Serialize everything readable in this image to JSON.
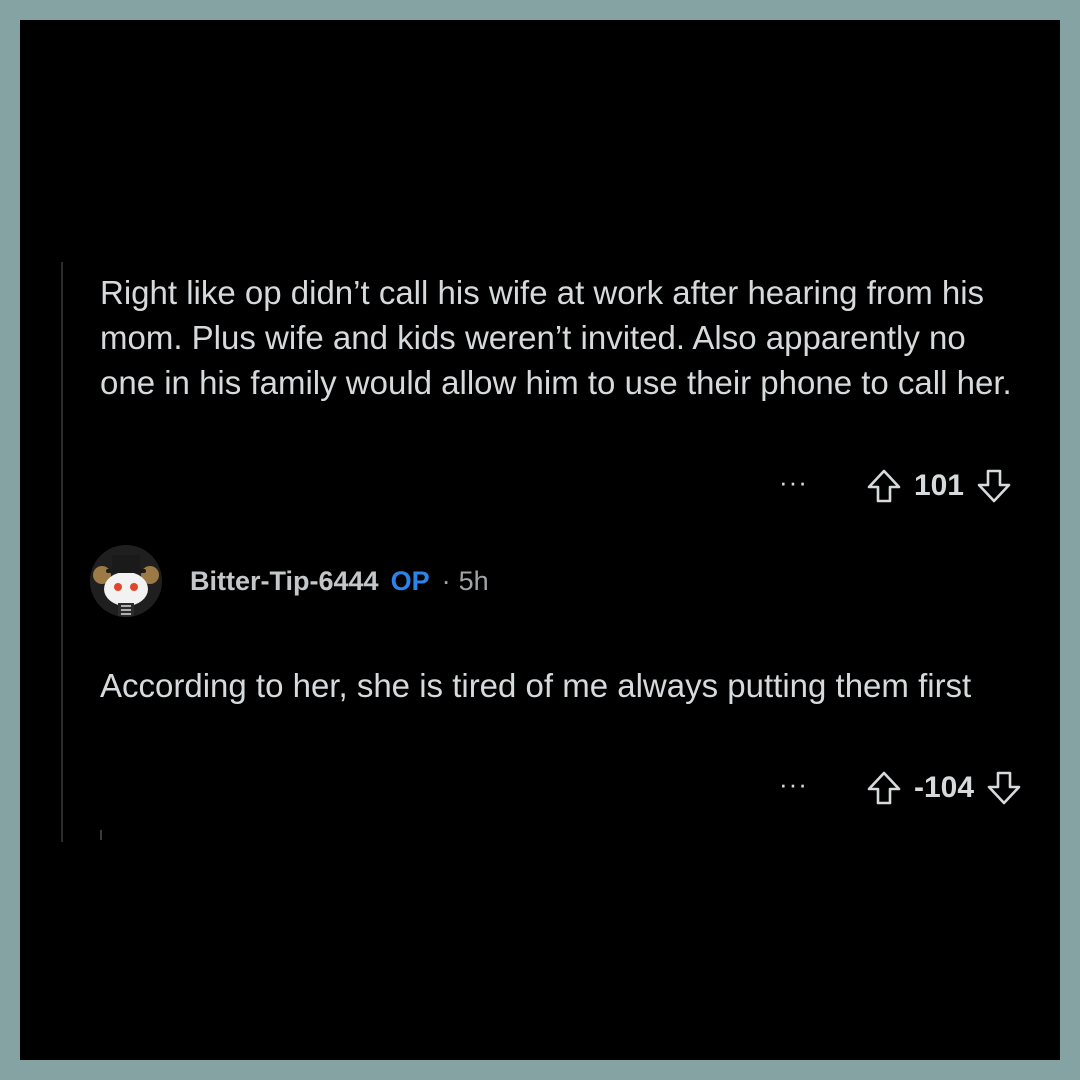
{
  "comments": [
    {
      "body": "Right like op didn’t call his wife at work after hearing from his mom. Plus wife and kids weren’t invited. Also apparently no one in his family would allow him to use their phone to call her.",
      "more_label": "···",
      "score": "101"
    },
    {
      "author": "Bitter-Tip-6444",
      "op_badge": "OP",
      "separator": "·",
      "age": "5h",
      "body": "According to her, she is tired of me always putting them first",
      "more_label": "···",
      "score": "-104"
    }
  ],
  "colors": {
    "background": "#000000",
    "frame": "#85a3a3",
    "text": "#d7dadc",
    "op_badge": "#2b84ea"
  },
  "icons": {
    "upvote": "arrow-up-outline-icon",
    "downvote": "arrow-down-outline-icon",
    "avatar": "snoo-avatar-top-hat"
  }
}
